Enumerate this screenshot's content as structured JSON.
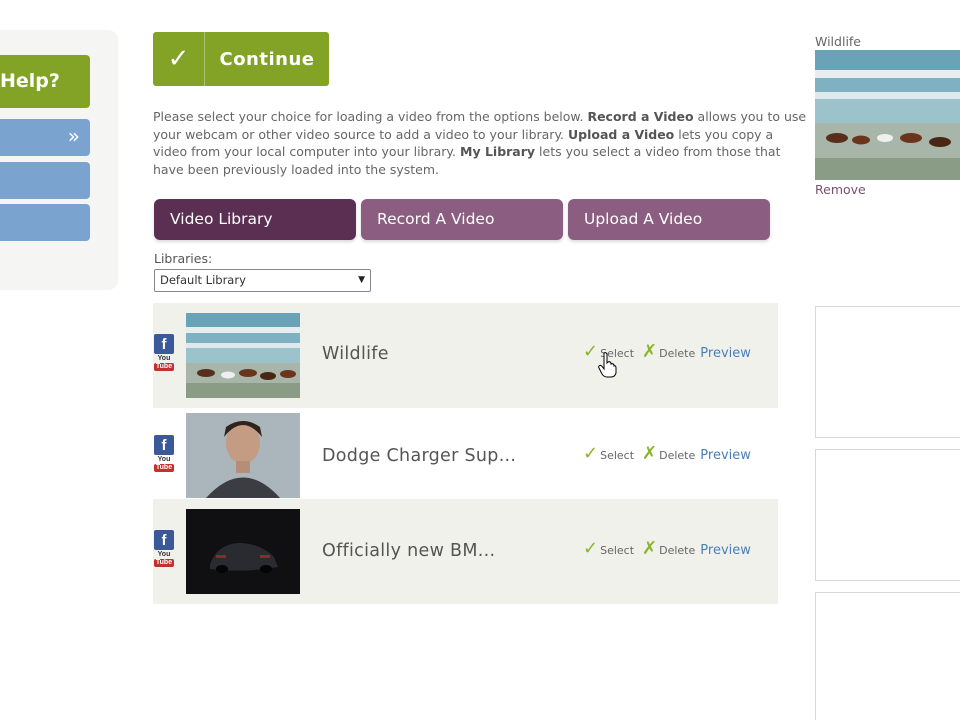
{
  "sidebar": {
    "help_label": "Help?",
    "chevron_glyph": "»"
  },
  "continue_button": {
    "check_glyph": "✓",
    "label": "Continue"
  },
  "instructions": {
    "p1": "Please select your choice for loading a video from the options below. ",
    "b1": "Record a Video",
    "p2": " allows you to use your webcam or other video source to add a video to your library. ",
    "b2": "Upload a Video",
    "p3": " lets you copy a video from your local computer into your library. ",
    "b3": "My Library",
    "p4": " lets you select a video from those that have been previously loaded into the system."
  },
  "tabs": [
    {
      "label": "Video Library",
      "active": true
    },
    {
      "label": "Record A Video",
      "active": false
    },
    {
      "label": "Upload A Video",
      "active": false
    }
  ],
  "libraries": {
    "label": "Libraries:",
    "selected": "Default Library"
  },
  "videos": [
    {
      "title": "Wildlife",
      "select_label": "Select",
      "delete_label": "Delete",
      "preview_label": "Preview"
    },
    {
      "title": "Dodge Charger Sup...",
      "select_label": "Select",
      "delete_label": "Delete",
      "preview_label": "Preview"
    },
    {
      "title": "Officially new BM...",
      "select_label": "Select",
      "delete_label": "Delete",
      "preview_label": "Preview"
    }
  ],
  "social": {
    "fb_glyph": "f",
    "yt_you": "You",
    "yt_tube": "Tube"
  },
  "selected_video": {
    "title": "Wildlife",
    "remove_label": "Remove"
  },
  "colors": {
    "accent_green": "#82a326",
    "tab_active": "#5b2f52",
    "tab_inactive": "#8b5d80",
    "sidebar_blue": "#7aa3cf",
    "link_blue": "#4a7fb5"
  }
}
